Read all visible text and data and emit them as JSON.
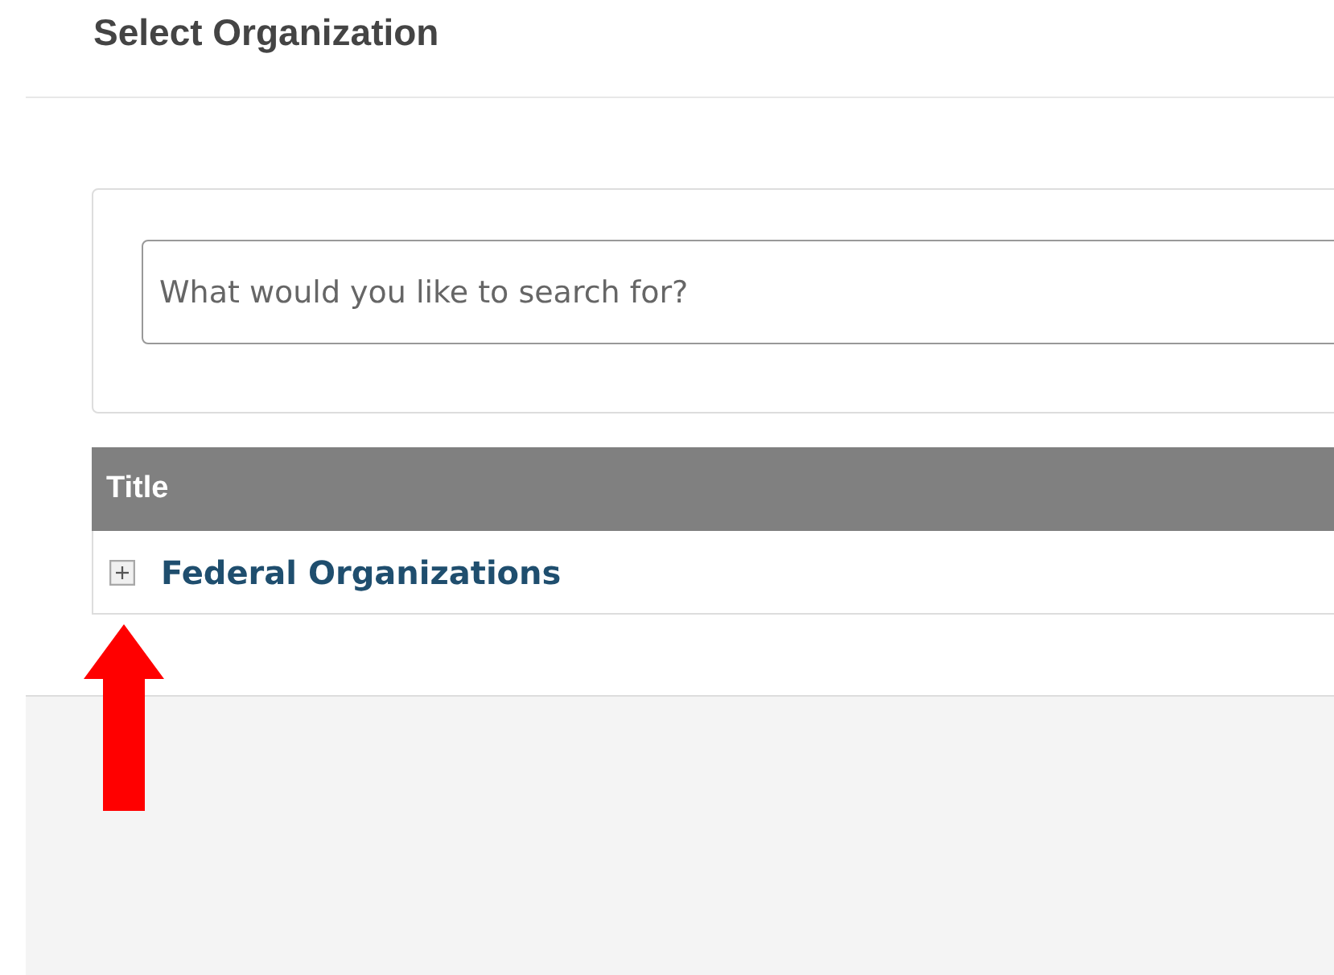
{
  "dialog": {
    "title": "Select Organization"
  },
  "search": {
    "placeholder": "What would you like to search for?"
  },
  "table": {
    "columns": [
      "Title"
    ],
    "rows": [
      {
        "title": "Federal Organizations",
        "expanded": false
      }
    ]
  },
  "annotation": {
    "kind": "arrow"
  }
}
